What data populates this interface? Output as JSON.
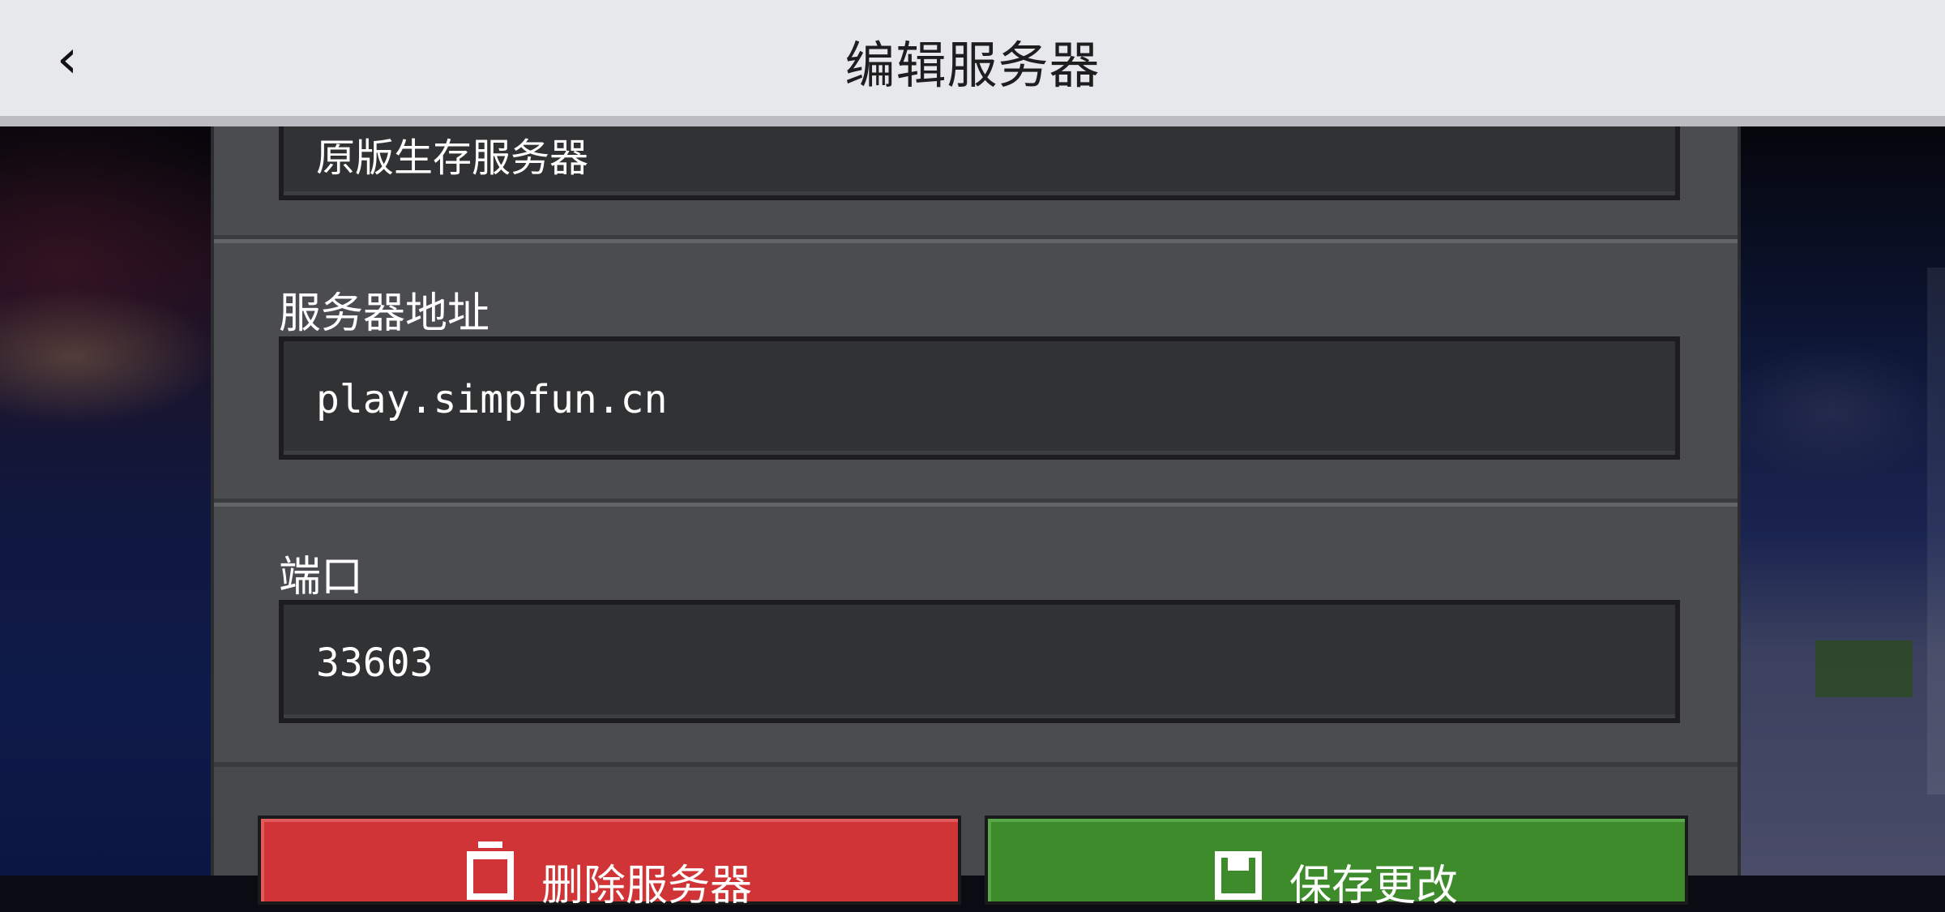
{
  "header": {
    "back_glyph": "‹",
    "title": "编辑服务器"
  },
  "form": {
    "name_value": "原版生存服务器",
    "address_label": "服务器地址",
    "address_value": "play.simpfun.cn",
    "port_label": "端口",
    "port_value": "33603"
  },
  "buttons": {
    "delete_label": "删除服务器",
    "delete_icon": "trash-icon",
    "save_label": "保存更改",
    "save_icon": "save-icon"
  },
  "colors": {
    "delete": "#d03436",
    "save": "#3d8b2b",
    "header": "#e7e8ec",
    "panel": "#48494c"
  }
}
